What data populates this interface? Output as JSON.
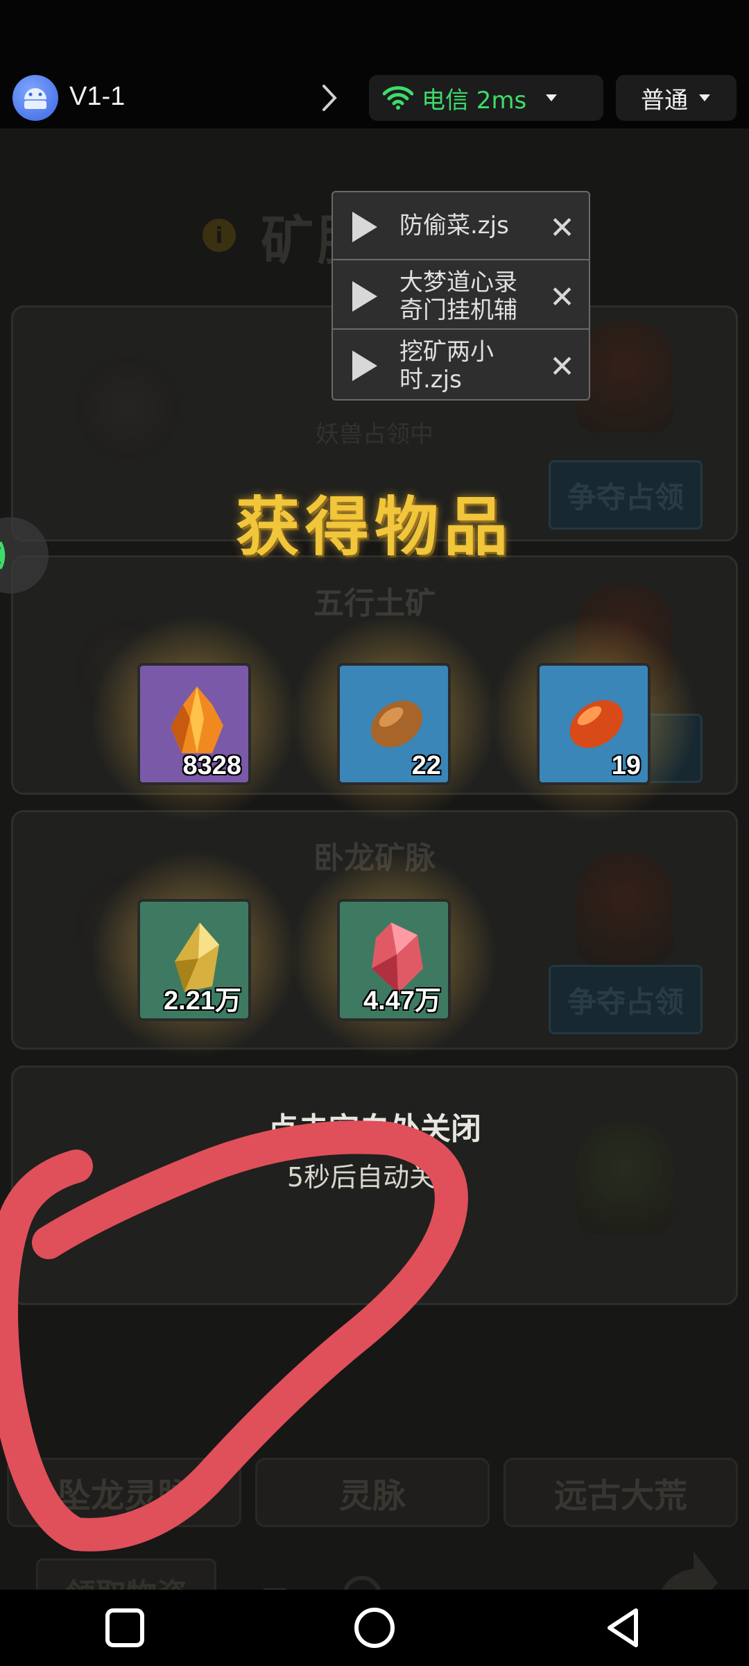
{
  "topbar": {
    "app_title": "V1-1",
    "network_label": "电信 2ms",
    "mode_label": "普通"
  },
  "colors": {
    "network_green": "#3ddc6a",
    "reward_gold": "#f1c63a",
    "scribble_red": "#e0505a"
  },
  "game": {
    "page_heading": "矿脉争夺",
    "info_icon": "i",
    "panels": [
      {
        "title": "五行",
        "status": "妖兽占领中",
        "button": "争夺占领"
      },
      {
        "title": "五行土矿",
        "status": "",
        "button": ""
      },
      {
        "title": "卧龙矿脉",
        "status": "",
        "button": "争夺占领"
      },
      {
        "title": "",
        "status": "",
        "button": ""
      }
    ],
    "tabs": [
      "坠龙灵脉",
      "灵脉",
      "远古大荒"
    ],
    "collect_button": "领取物资",
    "collect_day": "日"
  },
  "reward": {
    "title": "获得物品",
    "items": [
      {
        "icon": "fire-crystal-icon",
        "qty": "8328",
        "bg": "#7a5aa8"
      },
      {
        "icon": "earth-stone-icon",
        "qty": "22",
        "bg": "#3a86b8"
      },
      {
        "icon": "red-stone-icon",
        "qty": "19",
        "bg": "#3a86b8"
      },
      {
        "icon": "gold-crystal-icon",
        "qty": "2.21万",
        "bg": "#3e7a62"
      },
      {
        "icon": "pink-crystal-icon",
        "qty": "4.47万",
        "bg": "#3e7a62"
      }
    ],
    "close_hint": "点击空白处关闭",
    "auto_close": "5秒后自动关闭"
  },
  "script_menu": {
    "items": [
      {
        "name": "防偷菜.zjs"
      },
      {
        "name": "大梦道心录奇门挂机辅"
      },
      {
        "name": "挖矿两小时.zjs"
      }
    ]
  }
}
